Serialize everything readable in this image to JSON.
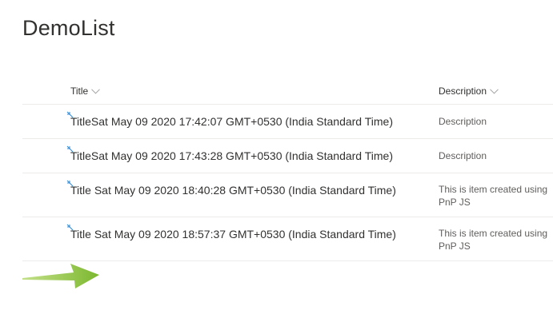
{
  "list": {
    "title": "DemoList",
    "columns": [
      {
        "label": "Title"
      },
      {
        "label": "Description"
      }
    ],
    "rows": [
      {
        "title": "TitleSat May 09 2020 17:42:07 GMT+0530 (India Standard Time)",
        "description": "Description"
      },
      {
        "title": "TitleSat May 09 2020 17:43:28 GMT+0530 (India Standard Time)",
        "description": "Description"
      },
      {
        "title": "Title Sat May 09 2020 18:40:28 GMT+0530 (India Standard Time)",
        "description": "This is item created using PnP JS"
      },
      {
        "title": "Title Sat May 09 2020 18:57:37 GMT+0530 (India Standard Time)",
        "description": "This is item created using PnP JS"
      }
    ]
  },
  "icons": {
    "new_item": "new-item-sparkle-icon",
    "sort": "chevron-down-icon",
    "annotation": "green-arrow-icon"
  },
  "colors": {
    "arrow": "#8dc63f",
    "new_indicator": "#2b88d8",
    "divider": "#edebe9"
  }
}
